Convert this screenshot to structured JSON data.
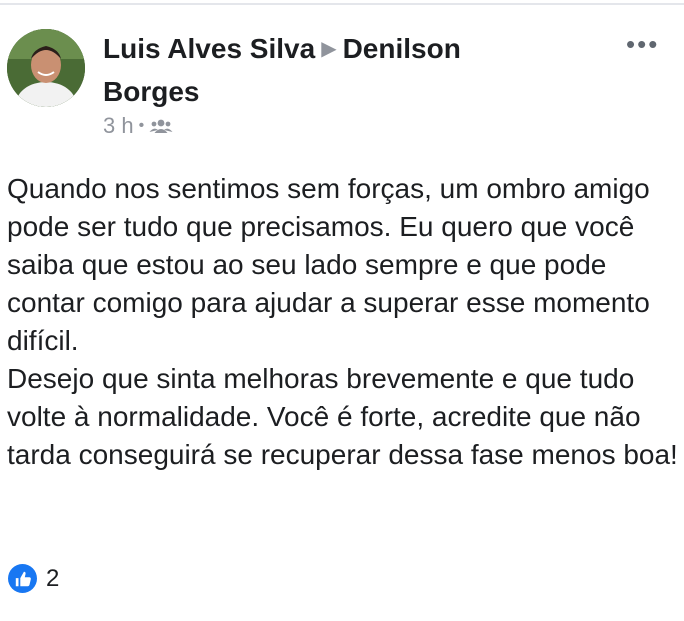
{
  "post": {
    "author": "Luis Alves Silva",
    "target": "Denilson Borges",
    "time": "3 h",
    "dot": "•",
    "privacy_icon": "friends-icon",
    "more_label": "•••",
    "body": [
      "Quando nos sentimos sem forças, um ombro amigo pode ser tudo que precisamos. Eu quero que você saiba que estou ao seu lado sempre e que pode contar comigo para ajudar a superar esse momento difícil.",
      "Desejo que sinta melhoras brevemente e que tudo volte à normalidade. Você é forte, acredite que não tarda conseguirá se recuperar dessa fase menos boa!"
    ],
    "reactions": {
      "icon": "like-icon",
      "count": "2"
    }
  },
  "colors": {
    "accent": "#1877f2",
    "text": "#1c1e21",
    "muted": "#90949c"
  }
}
